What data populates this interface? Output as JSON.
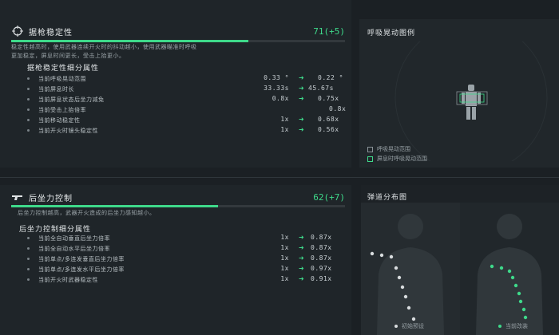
{
  "stability": {
    "title": "据枪稳定性",
    "value": "71(+5)",
    "fill_fraction": 0.71,
    "desc_lines": [
      "稳定性越高时，使用武器连续开火时的抖动越小，使用武器瞄准时呼吸",
      "更加稳定，屏息时间更长，受击上抬更小。"
    ],
    "subtitle": "据枪稳定性细分属性",
    "rows": [
      {
        "label": "当前呼吸晃动范围",
        "from": "0.33 °",
        "to": "0.22 °"
      },
      {
        "label": "当前屏息时长",
        "from": "33.33s",
        "to": "45.67s"
      },
      {
        "label": "当前屏息状态后坐力减免",
        "from": "0.8x",
        "to": "0.75x"
      },
      {
        "label": "当前受击上抬倍率",
        "from": "",
        "to": "0.8x"
      },
      {
        "label": "当前移动稳定性",
        "from": "1x",
        "to": "0.68x"
      },
      {
        "label": "当前开火时镜头稳定性",
        "from": "1x",
        "to": "0.56x"
      }
    ]
  },
  "breathing": {
    "title": "呼吸晃动图例",
    "legend": [
      "呼吸晃动范围",
      "屏息时呼吸晃动范围"
    ]
  },
  "recoil": {
    "title": "后坐力控制",
    "value": "62(+7)",
    "fill_fraction": 0.62,
    "desc": "后坐力控制越高，武器开火造成的后坐力感知越小。",
    "subtitle": "后坐力控制细分属性",
    "rows": [
      {
        "label": "当前全自动垂直后坐力倍率",
        "from": "1x",
        "to": "0.87x"
      },
      {
        "label": "当前全自动水平后坐力倍率",
        "from": "1x",
        "to": "0.87x"
      },
      {
        "label": "当前单点/多连发垂直后坐力倍率",
        "from": "1x",
        "to": "0.87x"
      },
      {
        "label": "当前单点/多连发水平后坐力倍率",
        "from": "1x",
        "to": "0.97x"
      },
      {
        "label": "当前开火时武器稳定性",
        "from": "1x",
        "to": "0.91x"
      }
    ]
  },
  "distribution": {
    "title": "弹道分布图",
    "legend": [
      "初始预设",
      "当前改装"
    ]
  },
  "colors": {
    "accent": "#3ed98a",
    "initial_dot": "#d8dcde"
  }
}
